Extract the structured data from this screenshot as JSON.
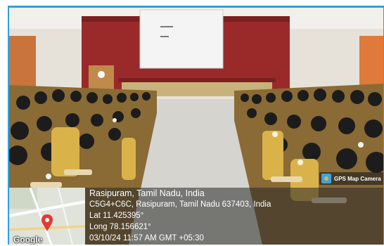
{
  "location": {
    "place": "Rasipuram, Tamil Nadu, India",
    "address": "C5G4+C6C, Rasipuram, Tamil Nadu 637403, India",
    "latitude": "Lat 11.425395°",
    "longitude": "Long 78.156621°",
    "timestamp": "03/10/24 11:57 AM GMT +05:30"
  },
  "badge": {
    "label": "GPS Map Camera"
  },
  "map": {
    "attribution": "Google"
  },
  "colors": {
    "border": "#28a3e6",
    "curtain": "#9a2a2a",
    "uniform": "#d9b24a",
    "wall": "#e6e2da"
  }
}
